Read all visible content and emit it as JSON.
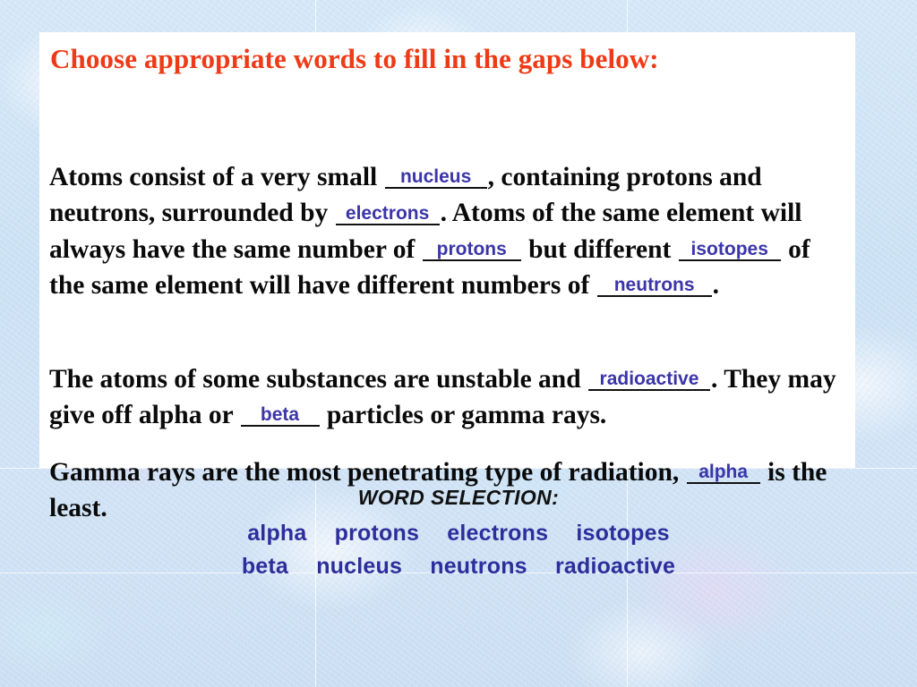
{
  "slide": {
    "title": "Choose appropriate words to fill in the gaps below:",
    "title_color": "#ee3a16",
    "panel_background": "#ffffff",
    "background_color": "#cde3f5",
    "answer_color": "#3b35a8",
    "word_list_color": "#2d2d9c"
  },
  "paragraph_1": {
    "t1": "Atoms consist of a very small ",
    "blank_1": "nucleus",
    "t2": ", containing protons and neutrons, surrounded by ",
    "blank_2": "electrons",
    "t3": ". Atoms of the same element will always have the same number of ",
    "blank_3": "protons",
    "t4": " but different ",
    "blank_4": "isotopes",
    "t5": " of the same element will have different numbers of ",
    "blank_5": "neutrons",
    "t6": "."
  },
  "paragraph_2": {
    "t1": "The atoms of some substances are unstable and ",
    "blank_1": "radioactive",
    "t2": ". They may give off alpha or ",
    "blank_2": "beta",
    "t3": " particles or gamma rays."
  },
  "paragraph_3": {
    "t1": "Gamma rays are the most penetrating type of radiation, ",
    "blank_1": "alpha",
    "t2": " is the least."
  },
  "word_selection": {
    "heading": "WORD SELECTION:",
    "row_1": [
      "alpha",
      "protons",
      "electrons",
      "isotopes"
    ],
    "row_2": [
      "beta",
      "nucleus",
      "neutrons",
      "radioactive"
    ]
  }
}
